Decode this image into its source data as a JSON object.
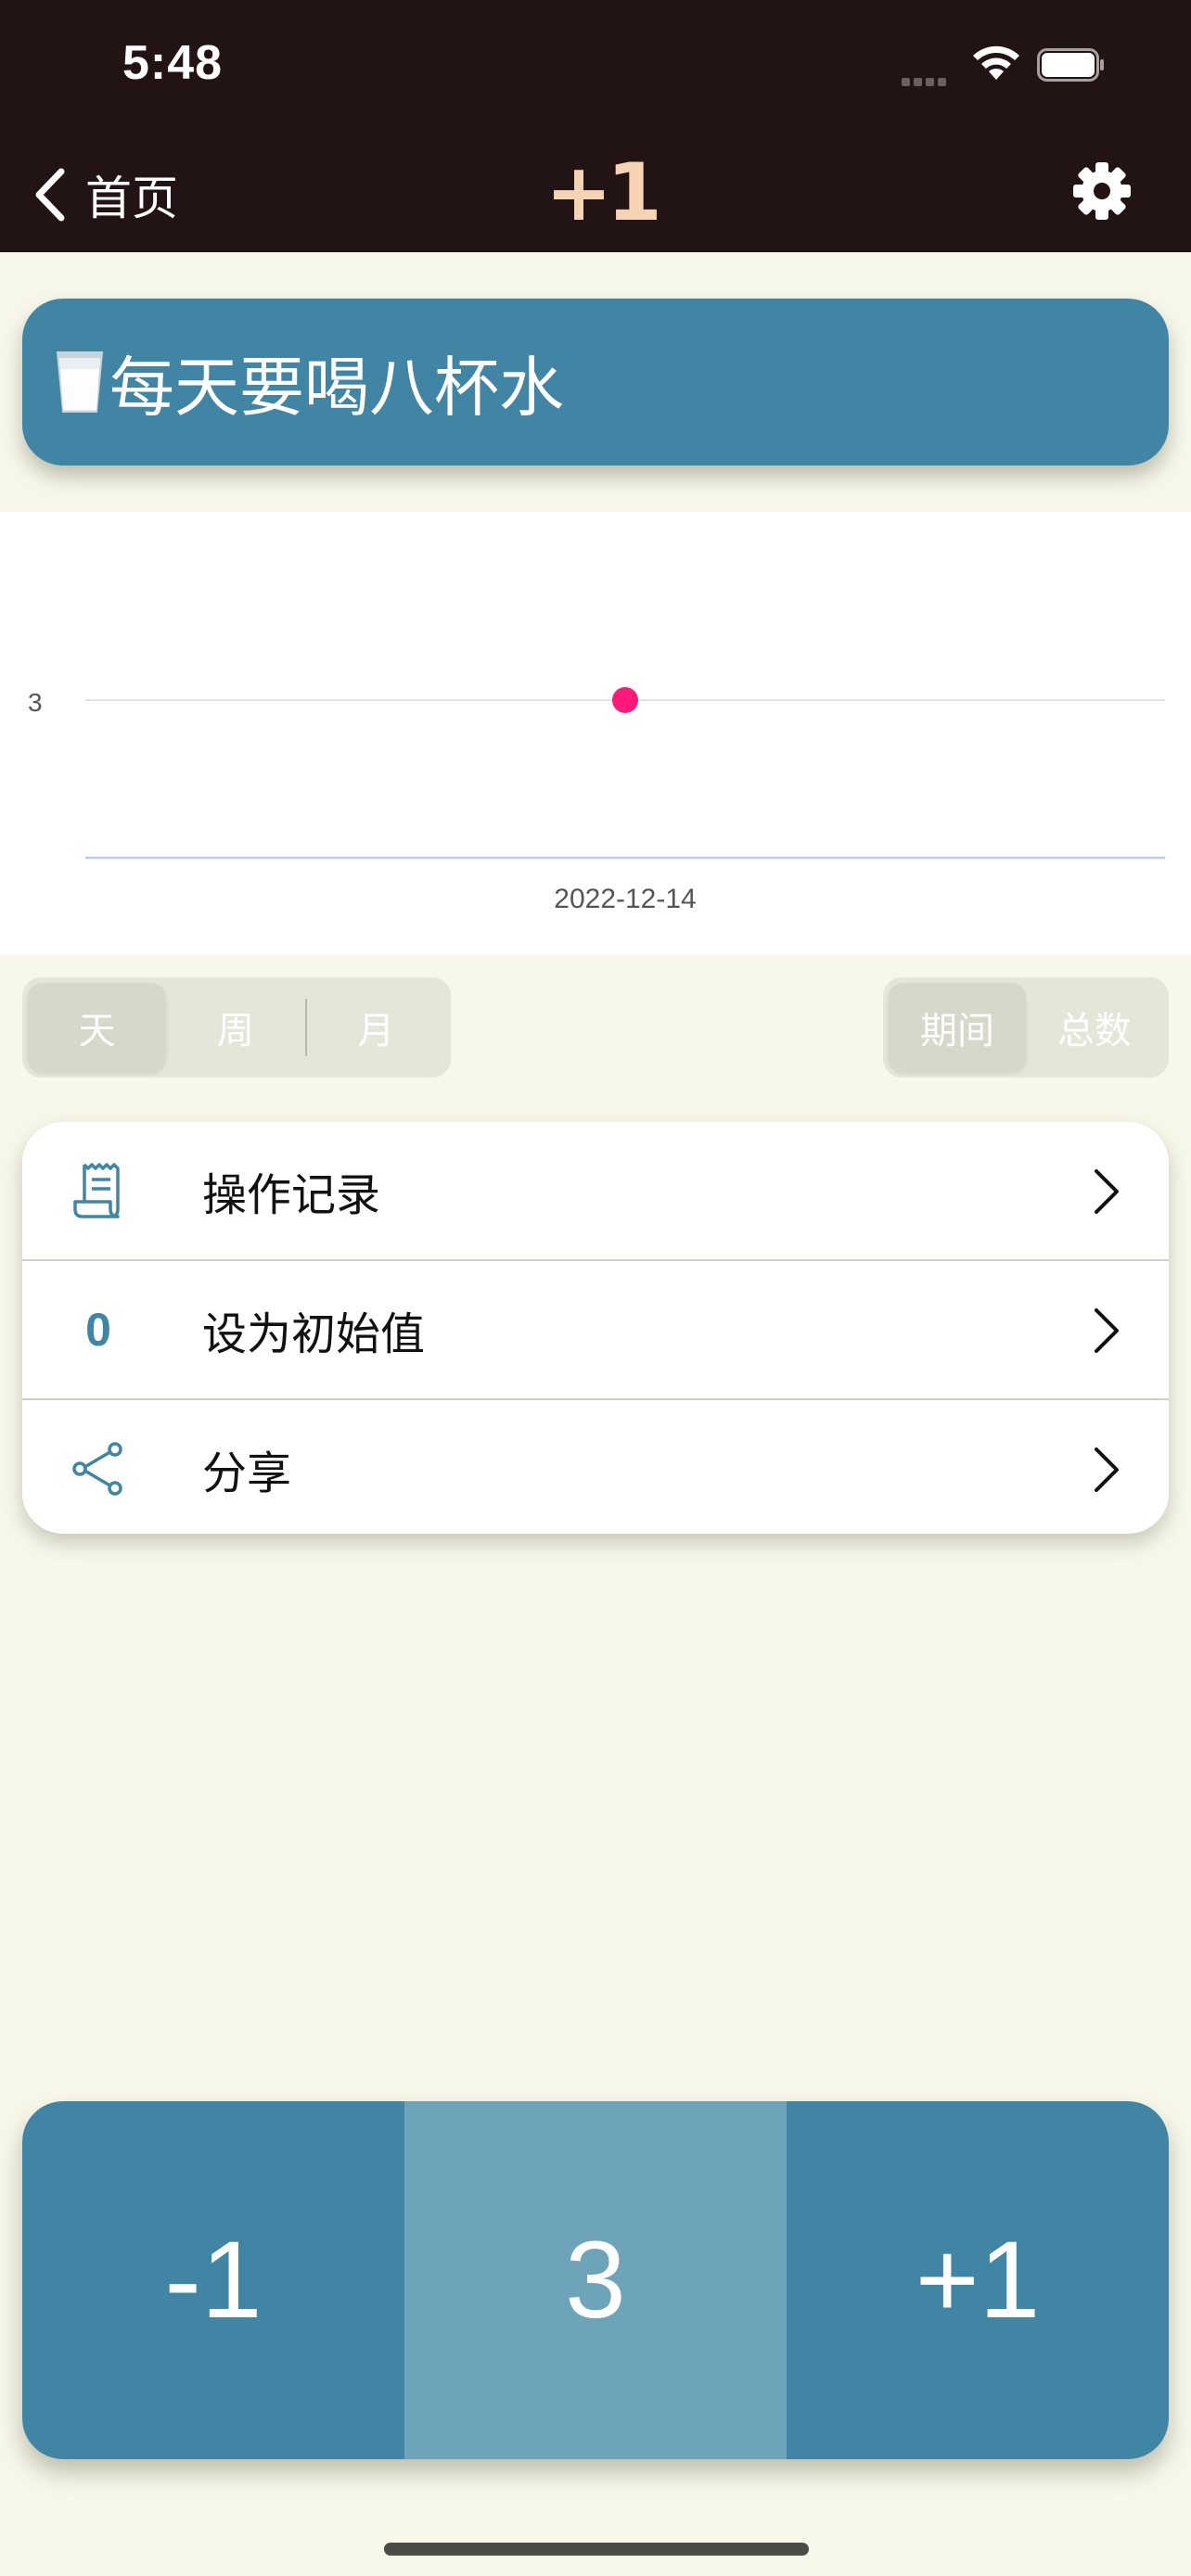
{
  "status_bar": {
    "time": "5:48"
  },
  "nav": {
    "back_label": "首页",
    "logo": "+1"
  },
  "counter_title": "每天要喝八杯水",
  "chart_data": {
    "type": "scatter",
    "x": [
      "2022-12-14"
    ],
    "series": [
      {
        "values": [
          3
        ],
        "color": "#ff1a7a"
      }
    ],
    "y_tick_labels": [
      "3"
    ],
    "x_tick_labels": [
      "2022-12-14"
    ],
    "grid": true
  },
  "range_tabs": [
    "天",
    "周",
    "月"
  ],
  "range_tabs_selected": "天",
  "mode_tabs": [
    "期间",
    "总数"
  ],
  "mode_tabs_selected": "期间",
  "menu": {
    "history_label": "操作记录",
    "set_initial_icon_text": "0",
    "set_initial_label": "设为初始值",
    "share_label": "分享"
  },
  "counter": {
    "minus_label": "-1",
    "value": "3",
    "plus_label": "+1"
  },
  "colors": {
    "primary": "#4085a4",
    "count_bg": "#6ea4ba",
    "background": "#f8f8ea",
    "header_bg": "#221314",
    "logo": "#f6d3b2",
    "point": "#ff1a7a"
  }
}
